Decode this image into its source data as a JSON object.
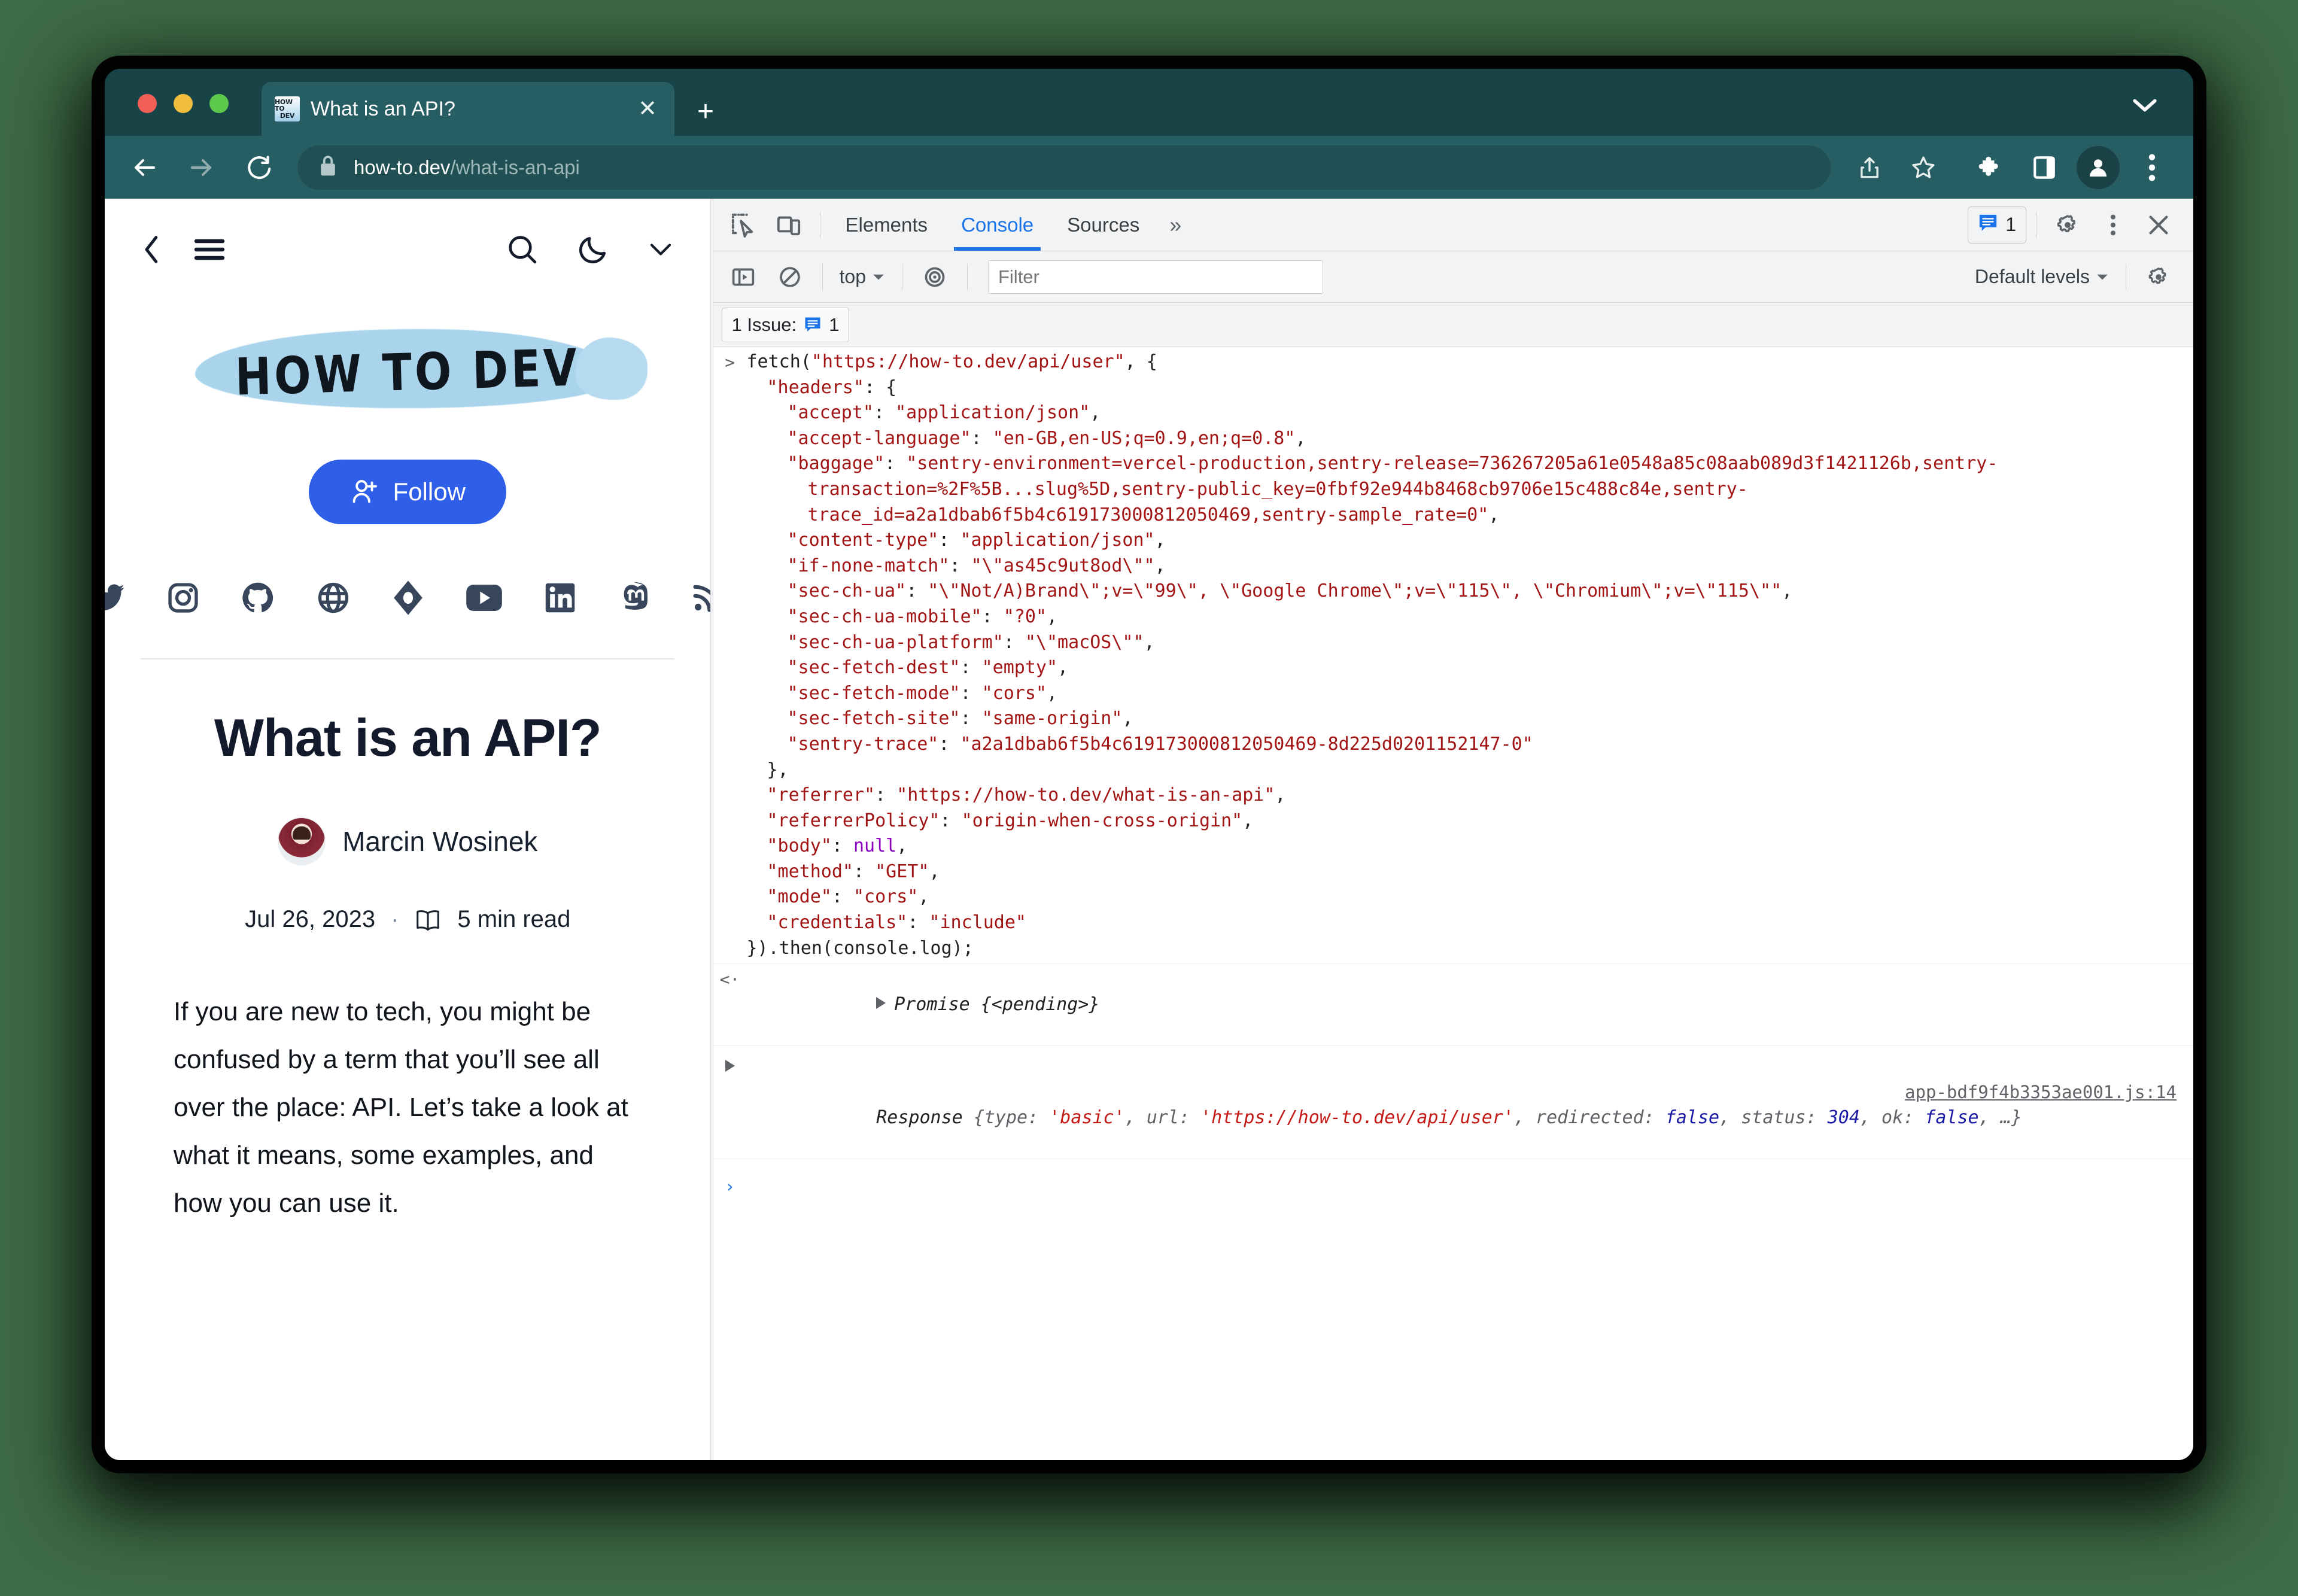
{
  "browser": {
    "tab": {
      "title": "What is an API?",
      "favicon_text_top": "HOW TO",
      "favicon_text_bottom": "DEV",
      "close_label": "✕"
    },
    "new_tab_label": "+",
    "omnibox": {
      "domain": "how-to.dev",
      "path": "/what-is-an-api",
      "full_url": "how-to.dev/what-is-an-api"
    },
    "icons": {
      "back": "back-arrow-icon",
      "forward": "forward-arrow-icon",
      "reload": "reload-icon",
      "lock": "lock-icon",
      "share": "share-icon",
      "bookmark": "star-icon",
      "extensions": "puzzle-icon",
      "side_panel": "side-panel-icon",
      "profile": "profile-avatar-icon",
      "menu": "three-dot-menu-icon",
      "tab_list": "chevron-down-icon"
    }
  },
  "page": {
    "header_icons": {
      "back": "chevron-left-icon",
      "menu": "hamburger-menu-icon",
      "search": "search-icon",
      "theme": "moon-icon",
      "expand": "chevron-down-icon"
    },
    "brand": "HOW TO DEV",
    "follow_label": "Follow",
    "socials": [
      {
        "name": "twitter-icon",
        "label": "Twitter"
      },
      {
        "name": "instagram-icon",
        "label": "Instagram"
      },
      {
        "name": "github-icon",
        "label": "GitHub"
      },
      {
        "name": "globe-icon",
        "label": "Website"
      },
      {
        "name": "dev-diamond-icon",
        "label": "DEV"
      },
      {
        "name": "youtube-icon",
        "label": "YouTube"
      },
      {
        "name": "linkedin-icon",
        "label": "LinkedIn"
      },
      {
        "name": "mastodon-icon",
        "label": "Mastodon"
      },
      {
        "name": "rss-icon",
        "label": "RSS"
      }
    ],
    "article": {
      "title": "What is an API?",
      "author": "Marcin Wosinek",
      "date": "Jul 26, 2023",
      "separator": "·",
      "read_time": "5 min read",
      "body": "If you are new to tech, you might be confused by a term that you’ll see all over the place: API. Let’s take a look at what it means, some examples, and how you can use it."
    }
  },
  "devtools": {
    "tabs": [
      {
        "label": "Elements",
        "active": false
      },
      {
        "label": "Console",
        "active": true
      },
      {
        "label": "Sources",
        "active": false
      }
    ],
    "more_tabs_label": "»",
    "issues_count": "1",
    "issues_banner": "1 Issue:",
    "issues_banner_count": "1",
    "console_bar": {
      "context": "top",
      "filter_placeholder": "Filter",
      "filter_value": "",
      "levels": "Default levels"
    },
    "icons": {
      "inspect": "inspect-element-icon",
      "device": "device-toolbar-icon",
      "settings": "gear-icon",
      "more": "three-dot-menu-icon",
      "close": "close-icon",
      "sidebar": "console-sidebar-icon",
      "clear": "clear-console-icon",
      "eye": "live-expression-icon",
      "console_settings": "gear-icon",
      "issues_badge": "issues-badge-icon"
    },
    "console": {
      "input_lines": [
        {
          "indent": 0,
          "segments": [
            {
              "t": "fetch(",
              "c": "plain"
            },
            {
              "t": "\"https://how-to.dev/api/user\"",
              "c": "str"
            },
            {
              "t": ", {",
              "c": "plain"
            }
          ]
        },
        {
          "indent": 1,
          "segments": [
            {
              "t": "\"headers\"",
              "c": "str"
            },
            {
              "t": ": {",
              "c": "plain"
            }
          ]
        },
        {
          "indent": 2,
          "segments": [
            {
              "t": "\"accept\"",
              "c": "str"
            },
            {
              "t": ": ",
              "c": "plain"
            },
            {
              "t": "\"application/json\"",
              "c": "str"
            },
            {
              "t": ",",
              "c": "plain"
            }
          ]
        },
        {
          "indent": 2,
          "segments": [
            {
              "t": "\"accept-language\"",
              "c": "str"
            },
            {
              "t": ": ",
              "c": "plain"
            },
            {
              "t": "\"en-GB,en-US;q=0.9,en;q=0.8\"",
              "c": "str"
            },
            {
              "t": ",",
              "c": "plain"
            }
          ]
        },
        {
          "indent": 2,
          "segments": [
            {
              "t": "\"baggage\"",
              "c": "str"
            },
            {
              "t": ": ",
              "c": "plain"
            },
            {
              "t": "\"sentry-environment=vercel-production,sentry-release=736267205a61e0548a85c08aab089d3f1421126b,sentry-transaction=%2F%5B...slug%5D,sentry-public_key=0fbf92e944b8468cb9706e15c488c84e,sentry-trace_id=a2a1dbab6f5b4c619173000812050469,sentry-sample_rate=0\"",
              "c": "str"
            },
            {
              "t": ",",
              "c": "plain"
            }
          ]
        },
        {
          "indent": 2,
          "segments": [
            {
              "t": "\"content-type\"",
              "c": "str"
            },
            {
              "t": ": ",
              "c": "plain"
            },
            {
              "t": "\"application/json\"",
              "c": "str"
            },
            {
              "t": ",",
              "c": "plain"
            }
          ]
        },
        {
          "indent": 2,
          "segments": [
            {
              "t": "\"if-none-match\"",
              "c": "str"
            },
            {
              "t": ": ",
              "c": "plain"
            },
            {
              "t": "\"\\\"as45c9ut8od\\\"\"",
              "c": "str"
            },
            {
              "t": ",",
              "c": "plain"
            }
          ]
        },
        {
          "indent": 2,
          "segments": [
            {
              "t": "\"sec-ch-ua\"",
              "c": "str"
            },
            {
              "t": ": ",
              "c": "plain"
            },
            {
              "t": "\"\\\"Not/A)Brand\\\";v=\\\"99\\\", \\\"Google Chrome\\\";v=\\\"115\\\", \\\"Chromium\\\";v=\\\"115\\\"\"",
              "c": "str"
            },
            {
              "t": ",",
              "c": "plain"
            }
          ]
        },
        {
          "indent": 2,
          "segments": [
            {
              "t": "\"sec-ch-ua-mobile\"",
              "c": "str"
            },
            {
              "t": ": ",
              "c": "plain"
            },
            {
              "t": "\"?0\"",
              "c": "str"
            },
            {
              "t": ",",
              "c": "plain"
            }
          ]
        },
        {
          "indent": 2,
          "segments": [
            {
              "t": "\"sec-ch-ua-platform\"",
              "c": "str"
            },
            {
              "t": ": ",
              "c": "plain"
            },
            {
              "t": "\"\\\"macOS\\\"\"",
              "c": "str"
            },
            {
              "t": ",",
              "c": "plain"
            }
          ]
        },
        {
          "indent": 2,
          "segments": [
            {
              "t": "\"sec-fetch-dest\"",
              "c": "str"
            },
            {
              "t": ": ",
              "c": "plain"
            },
            {
              "t": "\"empty\"",
              "c": "str"
            },
            {
              "t": ",",
              "c": "plain"
            }
          ]
        },
        {
          "indent": 2,
          "segments": [
            {
              "t": "\"sec-fetch-mode\"",
              "c": "str"
            },
            {
              "t": ": ",
              "c": "plain"
            },
            {
              "t": "\"cors\"",
              "c": "str"
            },
            {
              "t": ",",
              "c": "plain"
            }
          ]
        },
        {
          "indent": 2,
          "segments": [
            {
              "t": "\"sec-fetch-site\"",
              "c": "str"
            },
            {
              "t": ": ",
              "c": "plain"
            },
            {
              "t": "\"same-origin\"",
              "c": "str"
            },
            {
              "t": ",",
              "c": "plain"
            }
          ]
        },
        {
          "indent": 2,
          "segments": [
            {
              "t": "\"sentry-trace\"",
              "c": "str"
            },
            {
              "t": ": ",
              "c": "plain"
            },
            {
              "t": "\"a2a1dbab6f5b4c619173000812050469-8d225d0201152147-0\"",
              "c": "str"
            }
          ]
        },
        {
          "indent": 1,
          "segments": [
            {
              "t": "},",
              "c": "plain"
            }
          ]
        },
        {
          "indent": 1,
          "segments": [
            {
              "t": "\"referrer\"",
              "c": "str"
            },
            {
              "t": ": ",
              "c": "plain"
            },
            {
              "t": "\"https://how-to.dev/what-is-an-api\"",
              "c": "str"
            },
            {
              "t": ",",
              "c": "plain"
            }
          ]
        },
        {
          "indent": 1,
          "segments": [
            {
              "t": "\"referrerPolicy\"",
              "c": "str"
            },
            {
              "t": ": ",
              "c": "plain"
            },
            {
              "t": "\"origin-when-cross-origin\"",
              "c": "str"
            },
            {
              "t": ",",
              "c": "plain"
            }
          ]
        },
        {
          "indent": 1,
          "segments": [
            {
              "t": "\"body\"",
              "c": "str"
            },
            {
              "t": ": ",
              "c": "plain"
            },
            {
              "t": "null",
              "c": "null"
            },
            {
              "t": ",",
              "c": "plain"
            }
          ]
        },
        {
          "indent": 1,
          "segments": [
            {
              "t": "\"method\"",
              "c": "str"
            },
            {
              "t": ": ",
              "c": "plain"
            },
            {
              "t": "\"GET\"",
              "c": "str"
            },
            {
              "t": ",",
              "c": "plain"
            }
          ]
        },
        {
          "indent": 1,
          "segments": [
            {
              "t": "\"mode\"",
              "c": "str"
            },
            {
              "t": ": ",
              "c": "plain"
            },
            {
              "t": "\"cors\"",
              "c": "str"
            },
            {
              "t": ",",
              "c": "plain"
            }
          ]
        },
        {
          "indent": 1,
          "segments": [
            {
              "t": "\"credentials\"",
              "c": "str"
            },
            {
              "t": ": ",
              "c": "plain"
            },
            {
              "t": "\"include\"",
              "c": "str"
            }
          ]
        },
        {
          "indent": 0,
          "segments": [
            {
              "t": "}).then(console.log);",
              "c": "plain"
            }
          ]
        }
      ],
      "result_promise": "Promise {<pending>}",
      "response_source": "app-bdf9f4b3353ae001.js:14",
      "response_segments": [
        {
          "t": "Response ",
          "c": "obj-name"
        },
        {
          "t": "{",
          "c": "gray"
        },
        {
          "t": "type: ",
          "c": "gray"
        },
        {
          "t": "'basic'",
          "c": "red"
        },
        {
          "t": ", ",
          "c": "gray"
        },
        {
          "t": "url: ",
          "c": "gray"
        },
        {
          "t": "'https://how-to.dev/api/user'",
          "c": "red"
        },
        {
          "t": ", ",
          "c": "gray"
        },
        {
          "t": "redirected: ",
          "c": "gray"
        },
        {
          "t": "false",
          "c": "blue"
        },
        {
          "t": ", ",
          "c": "gray"
        },
        {
          "t": "status: ",
          "c": "gray"
        },
        {
          "t": "304",
          "c": "blue"
        },
        {
          "t": ", ",
          "c": "gray"
        },
        {
          "t": "ok: ",
          "c": "gray"
        },
        {
          "t": "false",
          "c": "blue"
        },
        {
          "t": ", …}",
          "c": "gray"
        }
      ],
      "prompt_arrow": "›"
    }
  },
  "colors": {
    "desktop_bg": "#3d6b45",
    "chrome_tabstrip": "#184347",
    "chrome_toolbar": "#275e63",
    "accent_blue": "#1a73e8",
    "follow_blue": "#2f5fe8",
    "string_red": "#a31515",
    "null_purple": "#8c00bf",
    "brand_brush": "#a9d4ec",
    "social_navy": "#37465b"
  }
}
